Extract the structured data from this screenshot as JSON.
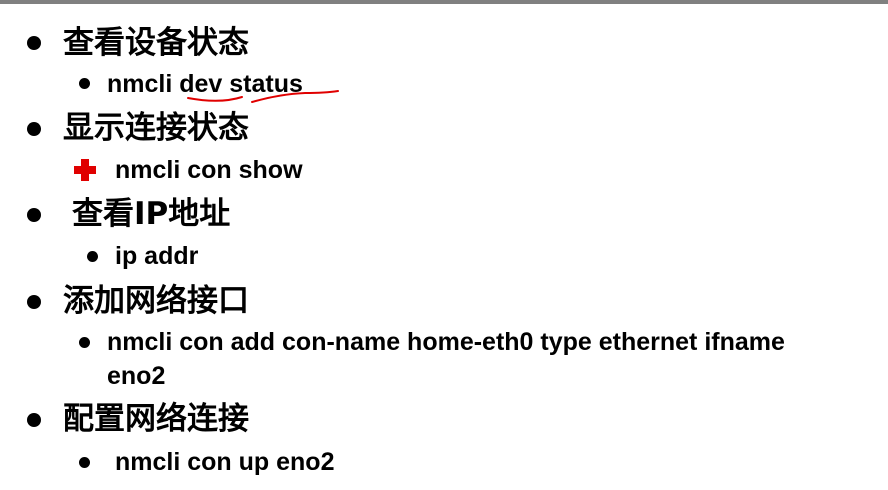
{
  "items": [
    {
      "heading": "查看设备状态",
      "commands": [
        "nmcli dev status"
      ]
    },
    {
      "heading": "显示连接状态",
      "commands": [
        "nmcli con show"
      ]
    },
    {
      "heading": "查看IP地址",
      "commands": [
        "ip addr"
      ]
    },
    {
      "heading": "添加网络接口",
      "commands": [
        "nmcli con add con-name home-eth0 type ethernet ifname",
        "eno2"
      ]
    },
    {
      "heading": "配置网络连接",
      "commands": [
        "nmcli con up eno2"
      ]
    }
  ],
  "icons": {
    "bullet": "filled-circle",
    "special_bullet": "red-cross-icon",
    "annotation": "red-handwritten-underline"
  },
  "colors": {
    "text": "#000000",
    "accent": "#e00000",
    "rule": "#808080"
  }
}
